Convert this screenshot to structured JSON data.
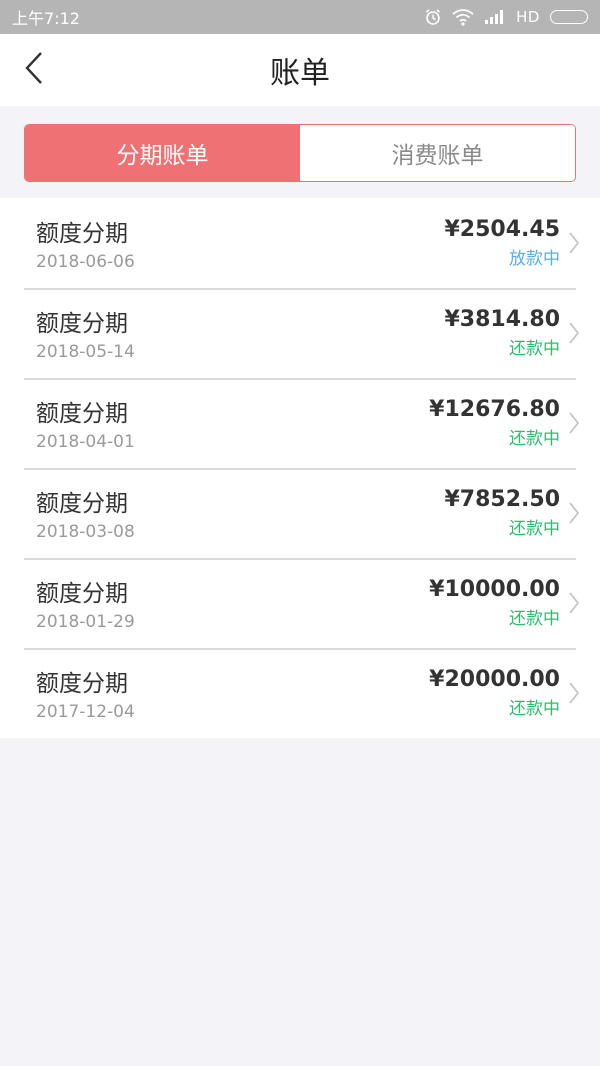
{
  "status_bar": {
    "time": "上午7:12",
    "network": "HD"
  },
  "header": {
    "title": "账单"
  },
  "tabs": [
    {
      "label": "分期账单",
      "active": true
    },
    {
      "label": "消费账单",
      "active": false
    }
  ],
  "colors": {
    "accent": "#f07173",
    "status_blue": "#5aaee8",
    "status_green": "#2dbe6c"
  },
  "bills": [
    {
      "name": "额度分期",
      "date": "2018-06-06",
      "amount": "¥2504.45",
      "status": "放款中",
      "status_color": "#5aaee8"
    },
    {
      "name": "额度分期",
      "date": "2018-05-14",
      "amount": "¥3814.80",
      "status": "还款中",
      "status_color": "#2dbe6c"
    },
    {
      "name": "额度分期",
      "date": "2018-04-01",
      "amount": "¥12676.80",
      "status": "还款中",
      "status_color": "#2dbe6c"
    },
    {
      "name": "额度分期",
      "date": "2018-03-08",
      "amount": "¥7852.50",
      "status": "还款中",
      "status_color": "#2dbe6c"
    },
    {
      "name": "额度分期",
      "date": "2018-01-29",
      "amount": "¥10000.00",
      "status": "还款中",
      "status_color": "#2dbe6c"
    },
    {
      "name": "额度分期",
      "date": "2017-12-04",
      "amount": "¥20000.00",
      "status": "还款中",
      "status_color": "#2dbe6c"
    }
  ]
}
